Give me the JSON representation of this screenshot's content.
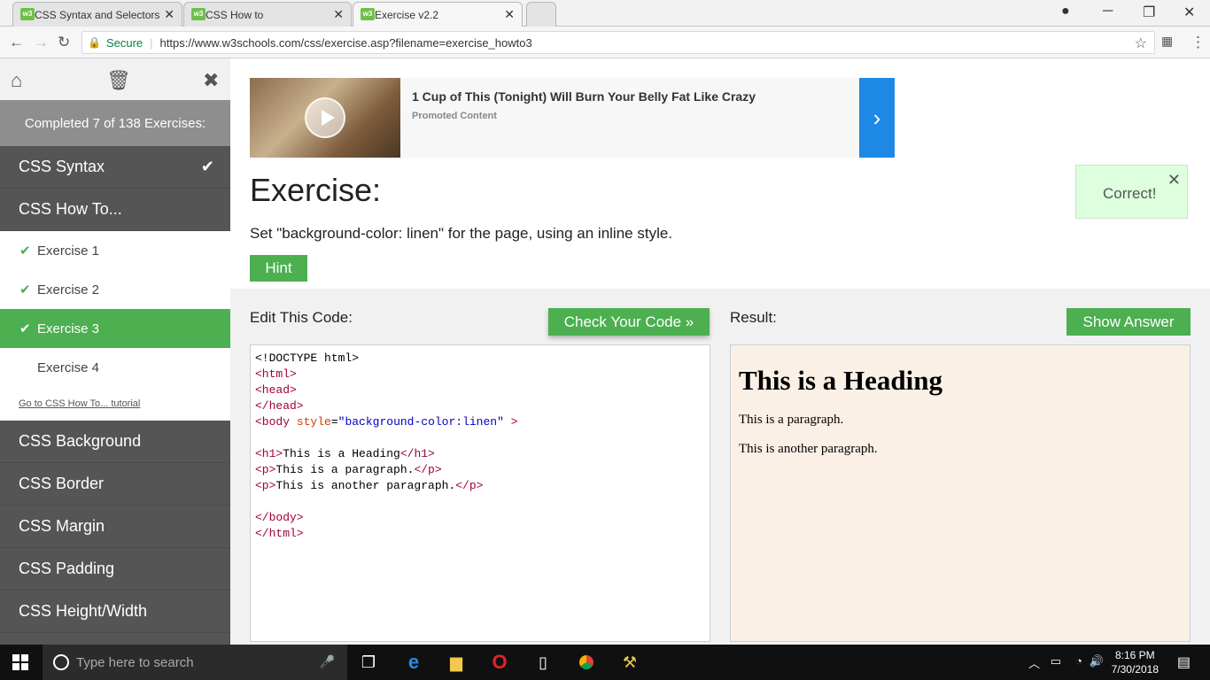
{
  "browser": {
    "tabs": [
      {
        "label": "CSS Syntax and Selectors",
        "active": false
      },
      {
        "label": "CSS How to",
        "active": false
      },
      {
        "label": "Exercise v2.2",
        "active": true
      }
    ],
    "secure_label": "Secure",
    "url": "https://www.w3schools.com/css/exercise.asp?filename=exercise_howto3"
  },
  "sidebar": {
    "completed_text": "Completed 7 of 138 Exercises:",
    "sections": [
      {
        "label": "CSS Syntax",
        "checked": true
      },
      {
        "label": "CSS How To..."
      }
    ],
    "exercises": [
      {
        "label": "Exercise 1",
        "checked": true
      },
      {
        "label": "Exercise 2",
        "checked": true
      },
      {
        "label": "Exercise 3",
        "checked": true,
        "active": true
      },
      {
        "label": "Exercise 4",
        "checked": false
      }
    ],
    "tutorial_link": "Go to CSS How To... tutorial",
    "more_sections": [
      "CSS Background",
      "CSS Border",
      "CSS Margin",
      "CSS Padding",
      "CSS Height/Width"
    ]
  },
  "ad": {
    "title": "1 Cup of This (Tonight) Will Burn Your Belly Fat Like Crazy",
    "subtitle": "Promoted Content"
  },
  "exercise": {
    "title": "Exercise:",
    "description": "Set \"background-color: linen\" for the page, using an inline style.",
    "hint_label": "Hint",
    "correct_text": "Correct!"
  },
  "editor": {
    "label": "Edit This Code:",
    "check_label": "Check Your Code »"
  },
  "result": {
    "label": "Result:",
    "show_answer_label": "Show Answer",
    "heading": "This is a Heading",
    "paragraphs": [
      "This is a paragraph.",
      "This is another paragraph."
    ]
  },
  "taskbar": {
    "search_placeholder": "Type here to search",
    "time": "8:16 PM",
    "date": "7/30/2018"
  },
  "colors": {
    "accent": "#4caf50",
    "sidebar_bg": "#555555",
    "result_bg": "#faf0e6",
    "ad_arrow": "#1e88e5"
  }
}
